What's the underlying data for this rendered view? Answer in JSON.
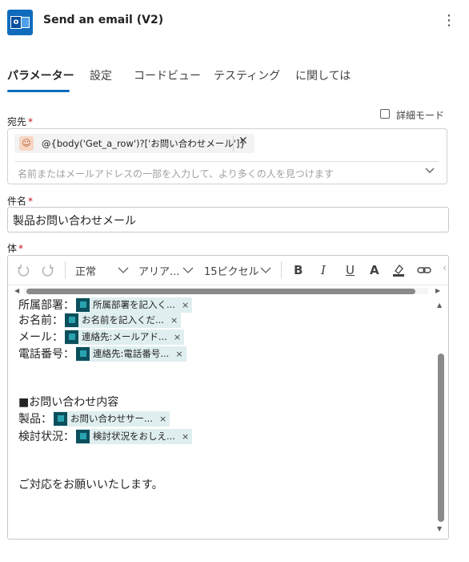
{
  "header": {
    "title": "Send an email (V2)",
    "more_icon": "more-vertical-icon",
    "app_icon": "outlook-icon"
  },
  "tabs": [
    {
      "label": "パラメーター",
      "active": true
    },
    {
      "label": "設定"
    },
    {
      "label": "コードビュー"
    },
    {
      "label": "テスティング"
    },
    {
      "label": "に関しては"
    }
  ],
  "to": {
    "label": "宛先",
    "required_mark": "*",
    "advanced_mode_label": "詳細モード",
    "token": "@{body('Get_a_row')?['お問い合わせメール']}",
    "token_close": "✕",
    "placeholder": "名前またはメールアドレスの一部を入力して、より多くの人を見つけます"
  },
  "subject": {
    "label": "件名",
    "required_mark": "*",
    "value": "製品お問い合わせメール"
  },
  "body": {
    "label": "体",
    "required_mark": "*",
    "toolbar": {
      "undo_icon": "undo-icon",
      "redo_icon": "redo-icon",
      "paragraph_format": "正常",
      "font": "アリア...",
      "font_size": "15ピクセル",
      "bold": "B",
      "italic": "I",
      "underline": "U",
      "font_color": "A",
      "highlight_icon": "highlight-icon",
      "link_icon": "link-icon"
    },
    "lines": [
      {
        "text": "所属部署：",
        "token": "所属部署を記入く..."
      },
      {
        "text": "お名前：",
        "token": "お名前を記入くだ..."
      },
      {
        "text": "メール：",
        "token": "連絡先:メールアド..."
      },
      {
        "text": "電話番号：",
        "token": "連絡先:電話番号..."
      },
      {
        "text": "■お問い合わせ内容"
      },
      {
        "text": "製品：",
        "token": "お問い合わせサー..."
      },
      {
        "text": "検討状況：",
        "token": "検討状況をおしえ..."
      },
      {
        "text": "ご対応をお願いいたします。"
      }
    ],
    "token_close": "×"
  }
}
